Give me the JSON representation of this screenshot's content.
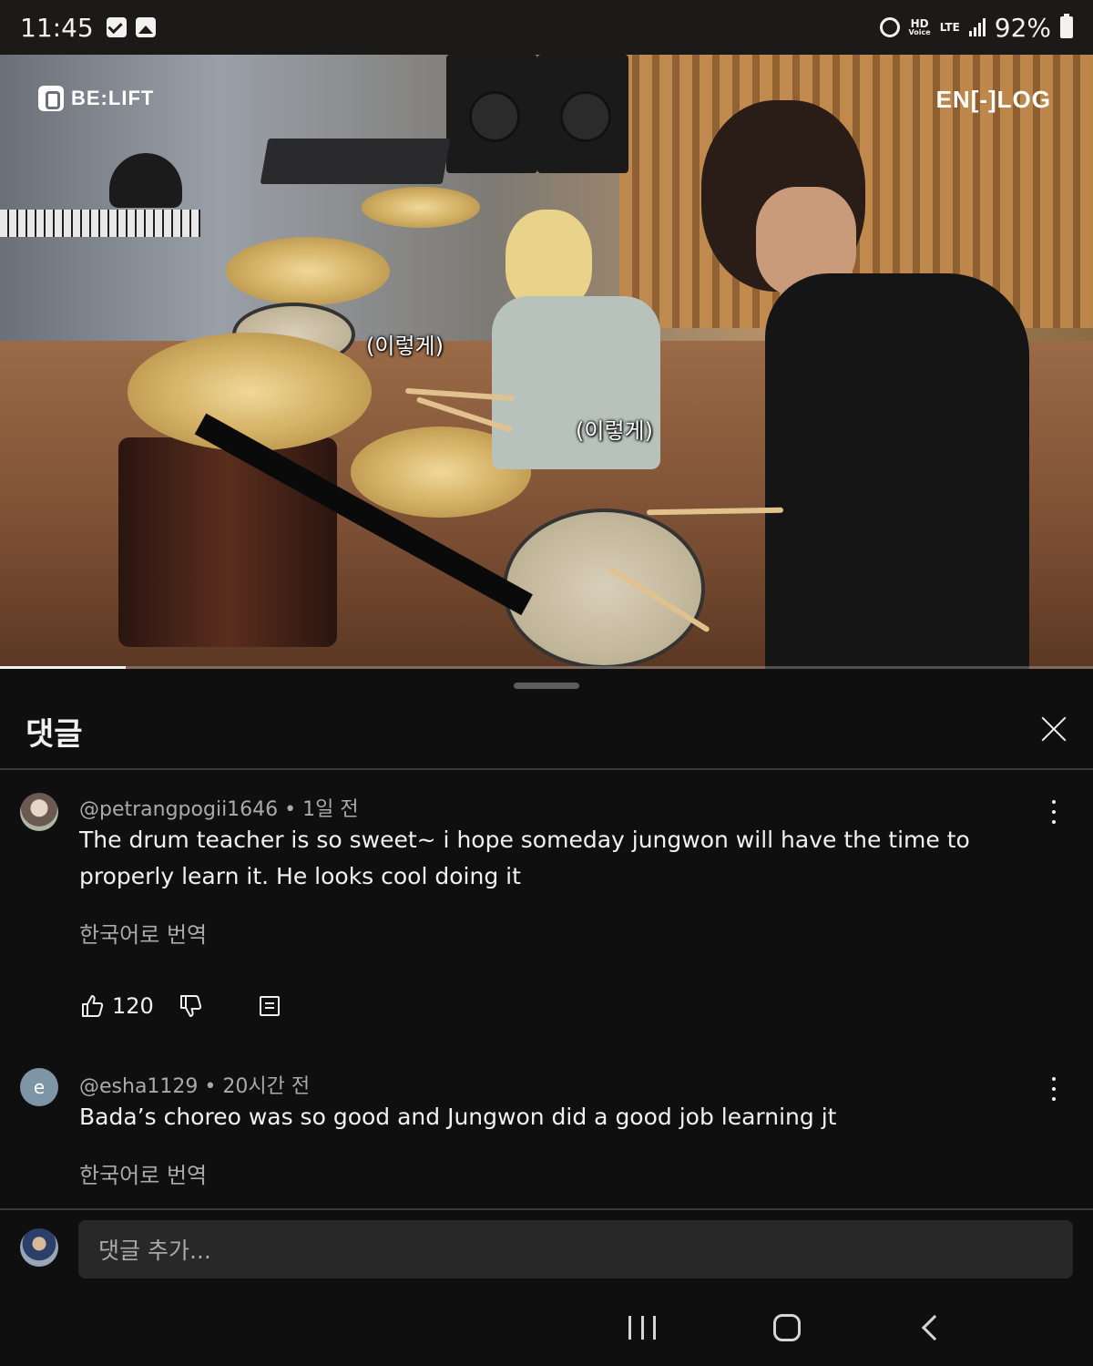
{
  "status_bar": {
    "time": "11:45",
    "network_top": "HD",
    "network_bottom": "Voice",
    "lte_label": "LTE",
    "battery": "92%",
    "icons": [
      "checkbox-notification-icon",
      "gallery-notification-icon",
      "alarm-icon",
      "signal-icon",
      "battery-icon"
    ]
  },
  "video": {
    "logo_left": "BE:LIFT",
    "logo_right": "EN[-]LOG",
    "caption_1": "(이렇게)",
    "caption_2": "(이렇게)",
    "progress": 0.115
  },
  "comments_sheet": {
    "title": "댓글",
    "close_icon": "close-icon"
  },
  "comments": [
    {
      "author": "@petrangpogii1646",
      "separator": "•",
      "time": "1일 전",
      "text": "The drum teacher is so sweet~ i hope someday jungwon will have the time to properly learn it. He looks cool doing it",
      "translate": "한국어로 번역",
      "likes": "120"
    },
    {
      "author": "@esha1129",
      "avatar_letter": "e",
      "separator": "•",
      "time": "20시간 전",
      "text": "Bada’s choreo was so good and Jungwon did a good job learning jt",
      "translate": "한국어로 번역"
    }
  ],
  "add_comment": {
    "placeholder": "댓글 추가..."
  },
  "colors": {
    "background": "#0f0f0f",
    "text_primary": "#f1f1f1",
    "text_secondary": "#aaaaaa",
    "input_bg": "#282828"
  }
}
